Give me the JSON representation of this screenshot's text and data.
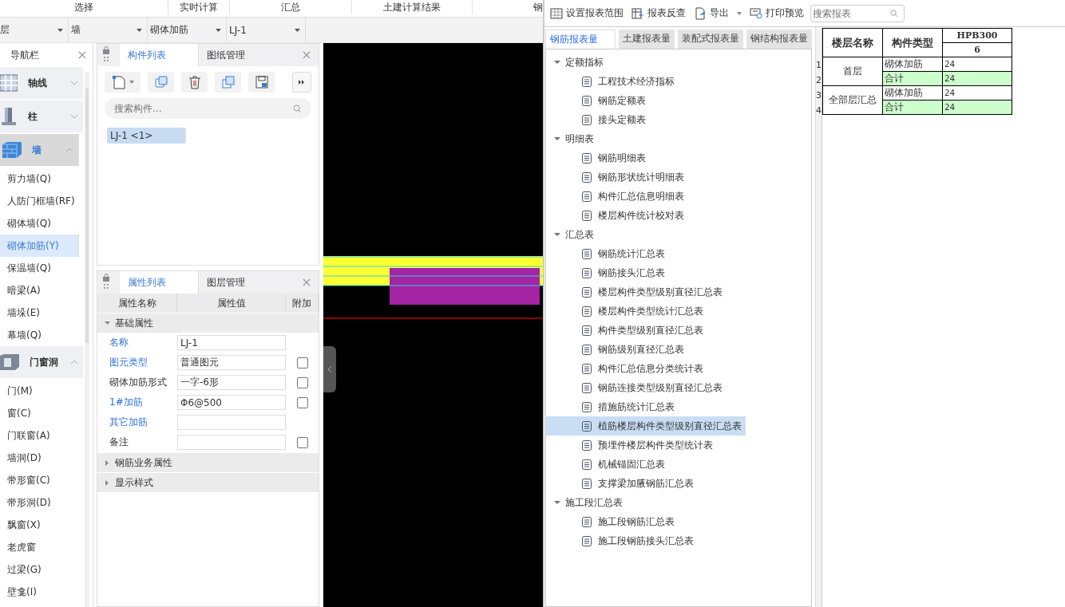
{
  "ribbon_groups": [
    "选择",
    "实时计算",
    "汇总",
    "土建计算结果",
    "钢"
  ],
  "selectors": [
    {
      "value": "层"
    },
    {
      "value": "墙"
    },
    {
      "value": "砌体加筋"
    },
    {
      "value": "LJ-1"
    }
  ],
  "navigator": {
    "title": "导航栏",
    "groups": [
      {
        "label": "轴线",
        "kind": "axis",
        "expanded": false,
        "selected": false
      },
      {
        "label": "柱",
        "kind": "column",
        "expanded": false,
        "selected": false
      },
      {
        "label": "墙",
        "kind": "wall",
        "expanded": true,
        "selected": true,
        "children": [
          {
            "label": "剪力墙(Q)",
            "selected": false
          },
          {
            "label": "人防门框墙(RF)",
            "selected": false
          },
          {
            "label": "砌体墙(Q)",
            "selected": false
          },
          {
            "label": "砌体加筋(Y)",
            "selected": true
          },
          {
            "label": "保温墙(Q)",
            "selected": false
          },
          {
            "label": "暗梁(A)",
            "selected": false
          },
          {
            "label": "墙垛(E)",
            "selected": false
          },
          {
            "label": "幕墙(Q)",
            "selected": false
          }
        ]
      },
      {
        "label": "门窗洞",
        "kind": "opening",
        "expanded": true,
        "selected": false,
        "children": [
          {
            "label": "门(M)",
            "selected": false
          },
          {
            "label": "窗(C)",
            "selected": false
          },
          {
            "label": "门联窗(A)",
            "selected": false
          },
          {
            "label": "墙洞(D)",
            "selected": false
          },
          {
            "label": "带形窗(C)",
            "selected": false
          },
          {
            "label": "带形洞(D)",
            "selected": false
          },
          {
            "label": "飘窗(X)",
            "selected": false
          },
          {
            "label": "老虎窗",
            "selected": false
          },
          {
            "label": "过梁(G)",
            "selected": false
          },
          {
            "label": "壁龛(I)",
            "selected": false
          }
        ]
      }
    ]
  },
  "component_panel": {
    "tabs": [
      {
        "label": "构件列表",
        "selected": true
      },
      {
        "label": "图纸管理",
        "selected": false
      }
    ],
    "search": {
      "placeholder": "搜索构件..."
    },
    "items": [
      {
        "label": "LJ-1 <1>",
        "selected": true
      }
    ]
  },
  "property_panel": {
    "tabs": [
      {
        "label": "属性列表",
        "selected": true
      },
      {
        "label": "图层管理",
        "selected": false
      }
    ],
    "columns": [
      "属性名称",
      "属性值",
      "附加"
    ],
    "groups": [
      {
        "label": "基础属性",
        "expanded": true,
        "rows": [
          {
            "name": "名称",
            "value": "LJ-1",
            "highlighted": true
          },
          {
            "name": "图元类型",
            "value": "普通图元",
            "highlighted": true,
            "checked": false
          },
          {
            "name": "砌体加筋形式",
            "value": "一字-6形",
            "highlighted": false,
            "checked": false
          },
          {
            "name": "1#加筋",
            "value": "Φ6@500",
            "highlighted": true,
            "checked": false
          },
          {
            "name": "其它加筋",
            "highlighted": true
          },
          {
            "name": "备注",
            "highlighted": false,
            "checked": false
          }
        ]
      },
      {
        "label": "钢筋业务属性",
        "expanded": false
      },
      {
        "label": "显示样式",
        "expanded": false
      }
    ]
  },
  "report": {
    "toolbar": [
      {
        "label": "设置报表范围",
        "kind": "range"
      },
      {
        "label": "报表反查",
        "kind": "trace"
      },
      {
        "label": "导出",
        "kind": "export"
      },
      {
        "label": "打印预览",
        "kind": "print"
      }
    ],
    "search": {
      "placeholder": "搜索报表"
    },
    "tabs": [
      {
        "label": "钢筋报表量",
        "selected": true
      },
      {
        "label": "土建报表量",
        "selected": false
      },
      {
        "label": "装配式报表量",
        "selected": false
      },
      {
        "label": "钢结构报表量",
        "selected": false
      }
    ],
    "tree": [
      {
        "label": "定额指标",
        "expanded": true,
        "children": [
          {
            "label": "工程技术经济指标",
            "selected": false
          },
          {
            "label": "钢筋定额表",
            "selected": false
          },
          {
            "label": "接头定额表",
            "selected": false
          }
        ]
      },
      {
        "label": "明细表",
        "expanded": true,
        "children": [
          {
            "label": "钢筋明细表",
            "selected": false
          },
          {
            "label": "钢筋形状统计明细表",
            "selected": false
          },
          {
            "label": "构件汇总信息明细表",
            "selected": false
          },
          {
            "label": "楼层构件统计校对表",
            "selected": false
          }
        ]
      },
      {
        "label": "汇总表",
        "expanded": true,
        "children": [
          {
            "label": "钢筋统计汇总表",
            "selected": false
          },
          {
            "label": "钢筋接头汇总表",
            "selected": false
          },
          {
            "label": "楼层构件类型级别直径汇总表",
            "selected": false
          },
          {
            "label": "楼层构件类型统计汇总表",
            "selected": false
          },
          {
            "label": "构件类型级别直径汇总表",
            "selected": false
          },
          {
            "label": "钢筋级别直径汇总表",
            "selected": false
          },
          {
            "label": "构件汇总信息分类统计表",
            "selected": false
          },
          {
            "label": "钢筋连接类型级别直径汇总表",
            "selected": false
          },
          {
            "label": "措施筋统计汇总表",
            "selected": false
          },
          {
            "label": "植筋楼层构件类型级别直径汇总表",
            "selected": true
          },
          {
            "label": "预埋件楼层构件类型统计表",
            "selected": false
          },
          {
            "label": "机械锚固汇总表",
            "selected": false
          },
          {
            "label": "支撑梁加腋钢筋汇总表",
            "selected": false
          }
        ]
      },
      {
        "label": "施工段汇总表",
        "expanded": true,
        "children": [
          {
            "label": "施工段钢筋汇总表",
            "selected": false
          },
          {
            "label": "施工段钢筋接头汇总表",
            "selected": false
          }
        ]
      }
    ],
    "sheet": {
      "headers": [
        "楼层名称",
        "构件类型",
        "HPB300",
        "6"
      ],
      "floors": [
        {
          "name": "首层",
          "rows": [
            {
              "number": "1",
              "type": "砌体加筋",
              "value": "24",
              "kind": "item"
            },
            {
              "number": "2",
              "type": "合计",
              "value": "24",
              "kind": "total"
            }
          ]
        },
        {
          "name": "全部层汇总",
          "rows": [
            {
              "number": "3",
              "type": "砌体加筋",
              "value": "24",
              "kind": "item"
            },
            {
              "number": "4",
              "type": "合计",
              "value": "24",
              "kind": "total"
            }
          ]
        }
      ]
    }
  }
}
